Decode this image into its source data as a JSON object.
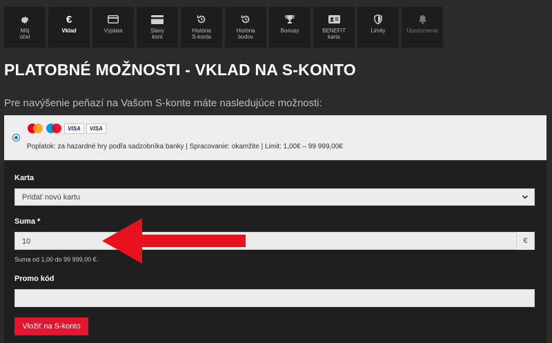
{
  "nav": {
    "items": [
      {
        "label": "Môj\núčet",
        "icon": "gear-icon"
      },
      {
        "label": "Vklad",
        "icon": "euro-icon"
      },
      {
        "label": "Výplata",
        "icon": "card-icon"
      },
      {
        "label": "Stavy\nkont",
        "icon": "wallet-icon"
      },
      {
        "label": "História\nS-konta",
        "icon": "history-icon"
      },
      {
        "label": "História\nbodov",
        "icon": "history-icon"
      },
      {
        "label": "Bonusy",
        "icon": "trophy-icon"
      },
      {
        "label": "BENEFIT\nkarta",
        "icon": "id-card-icon"
      },
      {
        "label": "Limity",
        "icon": "shield-icon"
      },
      {
        "label": "Upozornenia",
        "icon": "bell-icon"
      }
    ],
    "active_index": 1
  },
  "page": {
    "title": "PLATOBNÉ MOŽNOSTI - VKLAD NA S-KONTO",
    "subtitle": "Pre navýšenie peňazí na Vašom S-konte máte nasledujúce možnosti:"
  },
  "payment_option": {
    "cards": [
      "VISA",
      "VISA"
    ],
    "info": "Poplatok: za hazardné hry podľa sadzobníka banky | Spracovanie: okamžite | Limit: 1,00€ – 99 999,00€"
  },
  "form": {
    "card_label": "Karta",
    "card_selected": "Pridať novú kartu",
    "amount_label": "Suma *",
    "amount_value": "10",
    "currency": "€",
    "amount_hint": "Suma od 1,00 do 99 999,00 €.",
    "promo_label": "Promo kód",
    "promo_value": "",
    "submit_label": "Vložiť na S-konto"
  },
  "colors": {
    "accent": "#e2162f",
    "background": "#2b2b2b",
    "panel": "#1f1f1f"
  }
}
